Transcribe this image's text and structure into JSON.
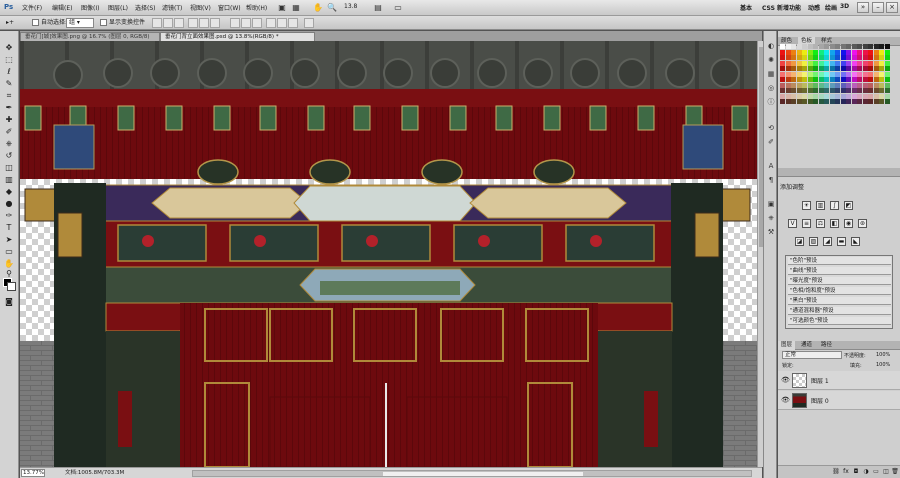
{
  "app": {
    "logo": "Ps",
    "menu": [
      "文件(F)",
      "编辑(E)",
      "图像(I)",
      "图层(L)",
      "选择(S)",
      "滤镜(T)",
      "视图(V)",
      "窗口(W)",
      "帮助(H)"
    ],
    "zoom_readout": "13.8",
    "workspaces": [
      "基本",
      "CSS 新增功能",
      "动感",
      "绘画",
      "3D"
    ],
    "more_workspaces": "»"
  },
  "options": {
    "auto_select_label": "自动选择:",
    "auto_select_value": "组",
    "show_transform_label": "显示变换控件"
  },
  "tabs": [
    {
      "label": "垂花门[城]效果图.png @ 16.7% (图层 0, RGB/8)",
      "active": false
    },
    {
      "label": "垂花门背立面效果图.psd @ 13.8%(RGB/8) *",
      "active": true
    }
  ],
  "status": {
    "zoom": "13.77%",
    "doc_info": "文档:1005.8M/703.3M"
  },
  "panels": {
    "swatch_tabs": [
      "颜色",
      "色板",
      "样式"
    ],
    "adjustments_title": "添加调整",
    "presets": [
      "\"色阶\"预设",
      "\"曲线\"预设",
      "\"曝光度\"预设",
      "\"色相/饱和度\"预设",
      "\"黑白\"预设",
      "\"通道混和器\"预设",
      "\"可选颜色\"预设"
    ],
    "layer_tabs": [
      "图层",
      "通道",
      "路径"
    ],
    "blend_mode": "正常",
    "opacity_label": "不透明度:",
    "opacity_value": "100%",
    "lock_label": "锁定:",
    "fill_label": "填充:",
    "fill_value": "100%",
    "layers": [
      {
        "name": "图层 1",
        "visible": true,
        "thumb": "transparent"
      },
      {
        "name": "图层 0",
        "visible": true,
        "thumb": "gate"
      }
    ]
  },
  "colors": {
    "roof": "#4a4d48",
    "beam_red": "#7a0f12",
    "door_red": "#6d0a0e",
    "column_green": "#1f2a22",
    "gold": "#b08a3a",
    "accent_blue": "#2a5f9e"
  }
}
